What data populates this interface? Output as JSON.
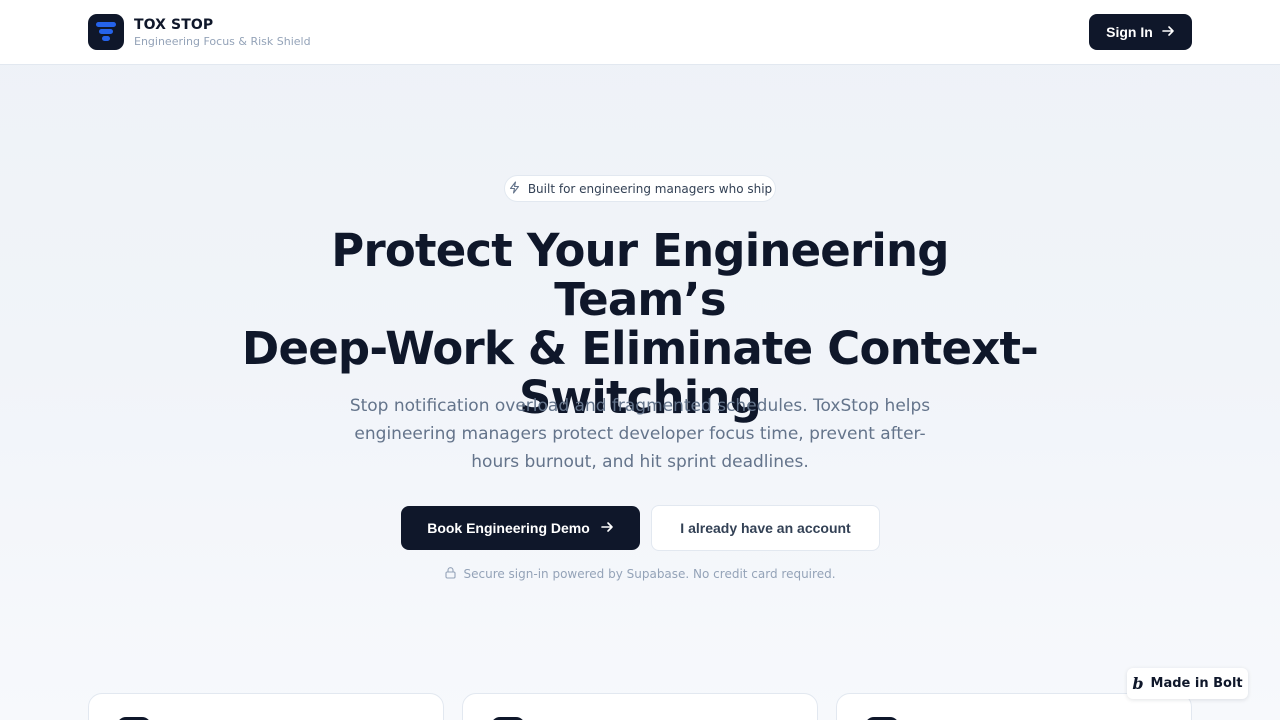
{
  "header": {
    "brand_name": "TOX STOP",
    "brand_tagline": "Engineering Focus & Risk Shield",
    "signin_label": "Sign In",
    "signin_icon": "arrow-right-icon"
  },
  "hero": {
    "badge_icon": "lightning-icon",
    "badge_text": "Built for engineering managers who ship",
    "title_line1": "Protect Your Engineering Team’s",
    "title_line2": "Deep-Work & Eliminate Context-",
    "title_line3": "Switching",
    "subtitle": "Stop notification overload and fragmented schedules. ToxStop helps engineering managers protect developer focus time, prevent after-hours burnout, and hit sprint deadlines.",
    "primary_cta": "Book Engineering Demo",
    "secondary_cta": "I already have an account",
    "secure_icon": "lock-icon",
    "secure_text": "Secure sign-in powered by Supabase. No credit card required."
  },
  "badge_widget": {
    "logo_glyph": "b",
    "label": "Made in Bolt"
  },
  "colors": {
    "primary": "#0f172a",
    "accent": "#2563eb",
    "muted_text": "#64748b",
    "border": "#e2e8f0"
  }
}
